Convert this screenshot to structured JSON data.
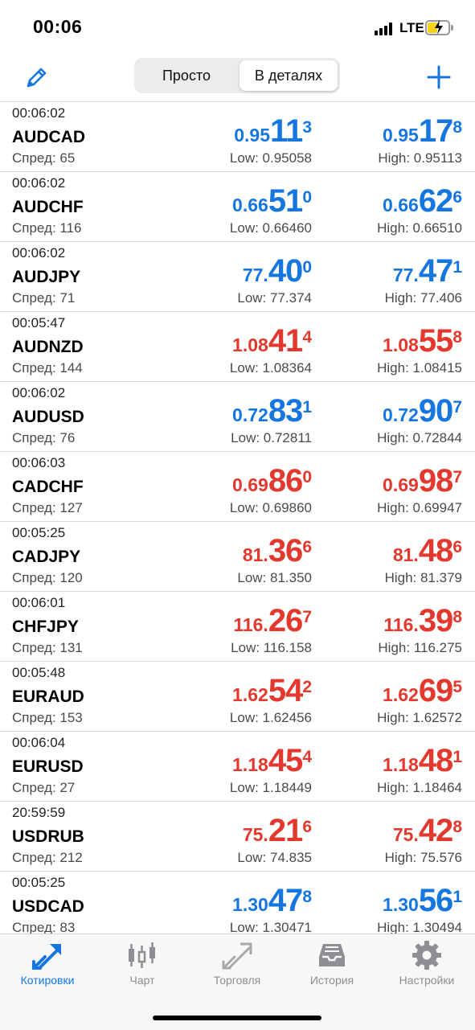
{
  "status_bar": {
    "time": "00:06",
    "network": "LTE"
  },
  "nav": {
    "segments": [
      "Просто",
      "В деталях"
    ],
    "selected_segment": "В деталях"
  },
  "colors": {
    "up": "#1576e0",
    "down": "#e3382d",
    "accent": "#1576e0"
  },
  "quotes": [
    {
      "time": "00:06:02",
      "symbol": "AUDCAD",
      "spread": "Спред: 65",
      "direction": "up",
      "bid": {
        "small": "0.95",
        "big": "11",
        "sup": "3"
      },
      "ask": {
        "small": "0.95",
        "big": "17",
        "sup": "8"
      },
      "low": "Low: 0.95058",
      "high": "High: 0.95113"
    },
    {
      "time": "00:06:02",
      "symbol": "AUDCHF",
      "spread": "Спред: 116",
      "direction": "up",
      "bid": {
        "small": "0.66",
        "big": "51",
        "sup": "0"
      },
      "ask": {
        "small": "0.66",
        "big": "62",
        "sup": "6"
      },
      "low": "Low: 0.66460",
      "high": "High: 0.66510"
    },
    {
      "time": "00:06:02",
      "symbol": "AUDJPY",
      "spread": "Спред: 71",
      "direction": "up",
      "bid": {
        "small": "77.",
        "big": "40",
        "sup": "0"
      },
      "ask": {
        "small": "77.",
        "big": "47",
        "sup": "1"
      },
      "low": "Low: 77.374",
      "high": "High: 77.406"
    },
    {
      "time": "00:05:47",
      "symbol": "AUDNZD",
      "spread": "Спред: 144",
      "direction": "down",
      "bid": {
        "small": "1.08",
        "big": "41",
        "sup": "4"
      },
      "ask": {
        "small": "1.08",
        "big": "55",
        "sup": "8"
      },
      "low": "Low: 1.08364",
      "high": "High: 1.08415"
    },
    {
      "time": "00:06:02",
      "symbol": "AUDUSD",
      "spread": "Спред: 76",
      "direction": "up",
      "bid": {
        "small": "0.72",
        "big": "83",
        "sup": "1"
      },
      "ask": {
        "small": "0.72",
        "big": "90",
        "sup": "7"
      },
      "low": "Low: 0.72811",
      "high": "High: 0.72844"
    },
    {
      "time": "00:06:03",
      "symbol": "CADCHF",
      "spread": "Спред: 127",
      "direction": "down",
      "bid": {
        "small": "0.69",
        "big": "86",
        "sup": "0"
      },
      "ask": {
        "small": "0.69",
        "big": "98",
        "sup": "7"
      },
      "low": "Low: 0.69860",
      "high": "High: 0.69947"
    },
    {
      "time": "00:05:25",
      "symbol": "CADJPY",
      "spread": "Спред: 120",
      "direction": "down",
      "bid": {
        "small": "81.",
        "big": "36",
        "sup": "6"
      },
      "ask": {
        "small": "81.",
        "big": "48",
        "sup": "6"
      },
      "low": "Low: 81.350",
      "high": "High: 81.379"
    },
    {
      "time": "00:06:01",
      "symbol": "CHFJPY",
      "spread": "Спред: 131",
      "direction": "down",
      "bid": {
        "small": "116.",
        "big": "26",
        "sup": "7"
      },
      "ask": {
        "small": "116.",
        "big": "39",
        "sup": "8"
      },
      "low": "Low: 116.158",
      "high": "High: 116.275"
    },
    {
      "time": "00:05:48",
      "symbol": "EURAUD",
      "spread": "Спред: 153",
      "direction": "down",
      "bid": {
        "small": "1.62",
        "big": "54",
        "sup": "2"
      },
      "ask": {
        "small": "1.62",
        "big": "69",
        "sup": "5"
      },
      "low": "Low: 1.62456",
      "high": "High: 1.62572"
    },
    {
      "time": "00:06:04",
      "symbol": "EURUSD",
      "spread": "Спред: 27",
      "direction": "down",
      "bid": {
        "small": "1.18",
        "big": "45",
        "sup": "4"
      },
      "ask": {
        "small": "1.18",
        "big": "48",
        "sup": "1"
      },
      "low": "Low: 1.18449",
      "high": "High: 1.18464"
    },
    {
      "time": "20:59:59",
      "symbol": "USDRUB",
      "spread": "Спред: 212",
      "direction": "down",
      "bid": {
        "small": "75.",
        "big": "21",
        "sup": "6"
      },
      "ask": {
        "small": "75.",
        "big": "42",
        "sup": "8"
      },
      "low": "Low: 74.835",
      "high": "High: 75.576"
    },
    {
      "time": "00:05:25",
      "symbol": "USDCAD",
      "spread": "Спред: 83",
      "direction": "up",
      "bid": {
        "small": "1.30",
        "big": "47",
        "sup": "8"
      },
      "ask": {
        "small": "1.30",
        "big": "56",
        "sup": "1"
      },
      "low": "Low: 1.30471",
      "high": "High: 1.30494"
    }
  ],
  "tabs": [
    {
      "label": "Котировки",
      "icon": "quotes-icon",
      "active": true
    },
    {
      "label": "Чарт",
      "icon": "chart-icon",
      "active": false
    },
    {
      "label": "Торговля",
      "icon": "trade-icon",
      "active": false
    },
    {
      "label": "История",
      "icon": "history-icon",
      "active": false
    },
    {
      "label": "Настройки",
      "icon": "settings-icon",
      "active": false
    }
  ]
}
